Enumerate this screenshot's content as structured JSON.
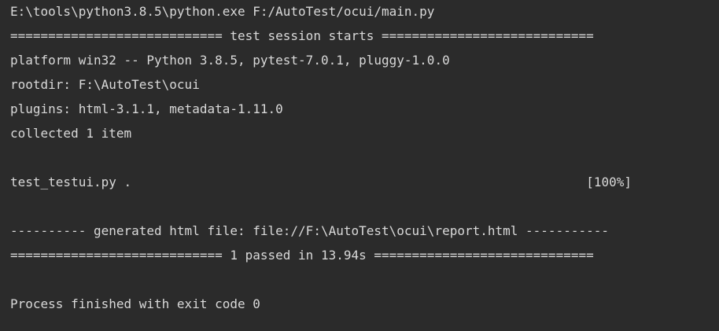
{
  "console": {
    "command": "E:\\tools\\python3.8.5\\python.exe F:/AutoTest/ocui/main.py",
    "session_header": "============================ test session starts ============================",
    "platform": "platform win32 -- Python 3.8.5, pytest-7.0.1, pluggy-1.0.0",
    "rootdir": "rootdir: F:\\AutoTest\\ocui",
    "plugins": "plugins: html-3.1.1, metadata-1.11.0",
    "collected": "collected 1 item",
    "test_file": "test_testui.py .",
    "progress": "[100%]",
    "html_report": "---------- generated html file: file://F:\\AutoTest\\ocui\\report.html -----------",
    "summary": "============================ 1 passed in 13.94s =============================",
    "exit": "Process finished with exit code 0"
  },
  "colors": {
    "background": "#2b2b2b",
    "text": "#d9d9d9"
  }
}
